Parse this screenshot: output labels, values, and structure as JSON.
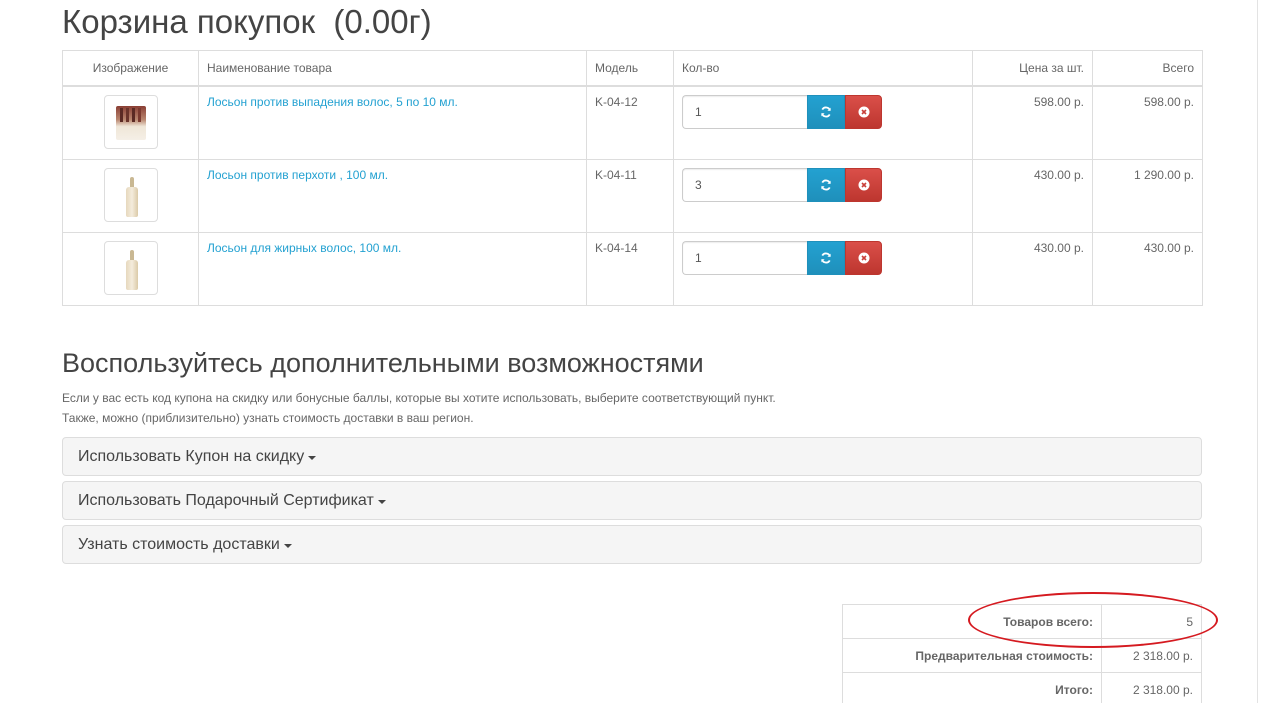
{
  "page": {
    "title": "Корзина покупок  (0.00г)"
  },
  "cart": {
    "headers": {
      "image": "Изображение",
      "name": "Наименование товара",
      "model": "Модель",
      "quantity": "Кол-во",
      "unit_price": "Цена за шт.",
      "total": "Всего"
    },
    "items": [
      {
        "name": "Лосьон против выпадения волос, 5 по 10 мл.",
        "model": "K-04-12",
        "quantity": "1",
        "unit_price": "598.00 р.",
        "total": "598.00 р."
      },
      {
        "name": "Лосьон против перхоти , 100 мл.",
        "model": "K-04-11",
        "quantity": "3",
        "unit_price": "430.00 р.",
        "total": "1 290.00 р."
      },
      {
        "name": "Лосьон для жирных волос, 100 мл.",
        "model": "K-04-14",
        "quantity": "1",
        "unit_price": "430.00 р.",
        "total": "430.00 р."
      }
    ],
    "colors": {
      "refresh": "#229ac8",
      "remove": "#da4f49",
      "link": "#23a1d1"
    }
  },
  "extras": {
    "title": "Воспользуйтесь дополнительными возможностями",
    "description_line1": "Если у вас есть код купона на скидку или бонусные баллы, которые вы хотите использовать, выберите соответствующий пункт.",
    "description_line2": "Также, можно (приблизительно) узнать стоимость доставки в ваш регион.",
    "panels": [
      {
        "label": "Использовать Купон на скидку"
      },
      {
        "label": "Использовать Подарочный Сертификат"
      },
      {
        "label": "Узнать стоимость доставки"
      }
    ]
  },
  "totals": {
    "rows": [
      {
        "label": "Товаров всего:",
        "value": "5"
      },
      {
        "label": "Предварительная стоимость:",
        "value": "2 318.00 р."
      },
      {
        "label": "Итого:",
        "value": "2 318.00 р."
      }
    ],
    "annotation_color": "#d51a20"
  }
}
